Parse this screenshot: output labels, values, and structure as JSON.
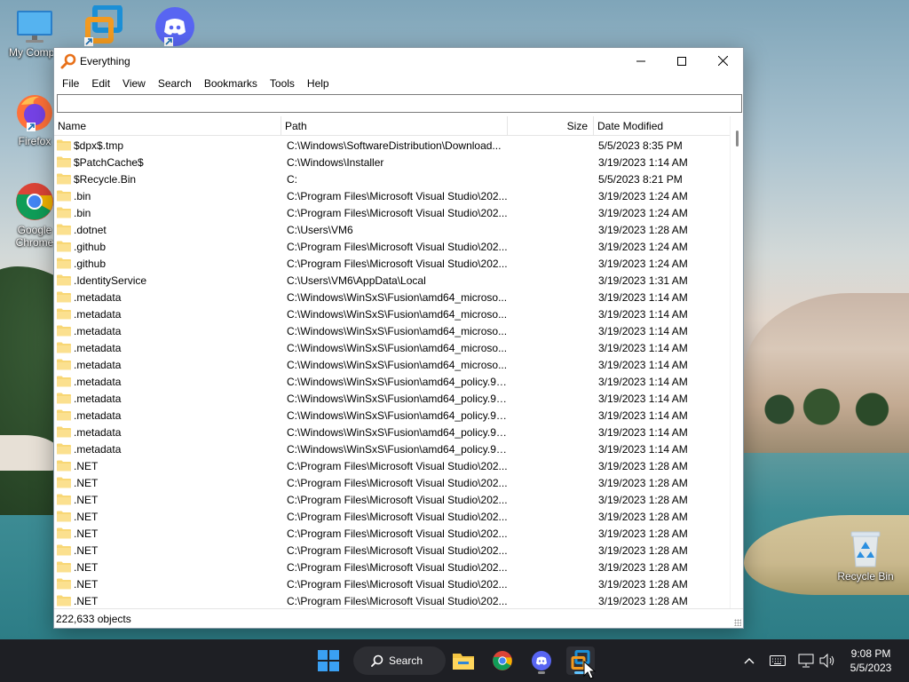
{
  "desktop": {
    "icons": [
      {
        "label": "My Compu",
        "icon": "monitor-icon"
      },
      {
        "label": "",
        "icon": "vmware-icon"
      },
      {
        "label": "",
        "icon": "discord-icon"
      },
      {
        "label": "Firefox",
        "icon": "firefox-icon"
      },
      {
        "label": "Google Chrome",
        "icon": "chrome-icon"
      },
      {
        "label": "Recycle Bin",
        "icon": "recycle-bin-icon"
      }
    ]
  },
  "window": {
    "title": "Everything",
    "menu": [
      "File",
      "Edit",
      "View",
      "Search",
      "Bookmarks",
      "Tools",
      "Help"
    ],
    "search_value": "",
    "columns": {
      "name": "Name",
      "path": "Path",
      "size": "Size",
      "date": "Date Modified"
    },
    "rows": [
      {
        "name": "$dpx$.tmp",
        "path": "C:\\Windows\\SoftwareDistribution\\Download...",
        "size": "",
        "date": "5/5/2023 8:35 PM"
      },
      {
        "name": "$PatchCache$",
        "path": "C:\\Windows\\Installer",
        "size": "",
        "date": "3/19/2023 1:14 AM"
      },
      {
        "name": "$Recycle.Bin",
        "path": "C:",
        "size": "",
        "date": "5/5/2023 8:21 PM"
      },
      {
        "name": ".bin",
        "path": "C:\\Program Files\\Microsoft Visual Studio\\202...",
        "size": "",
        "date": "3/19/2023 1:24 AM"
      },
      {
        "name": ".bin",
        "path": "C:\\Program Files\\Microsoft Visual Studio\\202...",
        "size": "",
        "date": "3/19/2023 1:24 AM"
      },
      {
        "name": ".dotnet",
        "path": "C:\\Users\\VM6",
        "size": "",
        "date": "3/19/2023 1:28 AM"
      },
      {
        "name": ".github",
        "path": "C:\\Program Files\\Microsoft Visual Studio\\202...",
        "size": "",
        "date": "3/19/2023 1:24 AM"
      },
      {
        "name": ".github",
        "path": "C:\\Program Files\\Microsoft Visual Studio\\202...",
        "size": "",
        "date": "3/19/2023 1:24 AM"
      },
      {
        "name": ".IdentityService",
        "path": "C:\\Users\\VM6\\AppData\\Local",
        "size": "",
        "date": "3/19/2023 1:31 AM"
      },
      {
        "name": ".metadata",
        "path": "C:\\Windows\\WinSxS\\Fusion\\amd64_microso...",
        "size": "",
        "date": "3/19/2023 1:14 AM"
      },
      {
        "name": ".metadata",
        "path": "C:\\Windows\\WinSxS\\Fusion\\amd64_microso...",
        "size": "",
        "date": "3/19/2023 1:14 AM"
      },
      {
        "name": ".metadata",
        "path": "C:\\Windows\\WinSxS\\Fusion\\amd64_microso...",
        "size": "",
        "date": "3/19/2023 1:14 AM"
      },
      {
        "name": ".metadata",
        "path": "C:\\Windows\\WinSxS\\Fusion\\amd64_microso...",
        "size": "",
        "date": "3/19/2023 1:14 AM"
      },
      {
        "name": ".metadata",
        "path": "C:\\Windows\\WinSxS\\Fusion\\amd64_microso...",
        "size": "",
        "date": "3/19/2023 1:14 AM"
      },
      {
        "name": ".metadata",
        "path": "C:\\Windows\\WinSxS\\Fusion\\amd64_policy.9....",
        "size": "",
        "date": "3/19/2023 1:14 AM"
      },
      {
        "name": ".metadata",
        "path": "C:\\Windows\\WinSxS\\Fusion\\amd64_policy.9....",
        "size": "",
        "date": "3/19/2023 1:14 AM"
      },
      {
        "name": ".metadata",
        "path": "C:\\Windows\\WinSxS\\Fusion\\amd64_policy.9....",
        "size": "",
        "date": "3/19/2023 1:14 AM"
      },
      {
        "name": ".metadata",
        "path": "C:\\Windows\\WinSxS\\Fusion\\amd64_policy.9....",
        "size": "",
        "date": "3/19/2023 1:14 AM"
      },
      {
        "name": ".metadata",
        "path": "C:\\Windows\\WinSxS\\Fusion\\amd64_policy.9....",
        "size": "",
        "date": "3/19/2023 1:14 AM"
      },
      {
        "name": ".NET",
        "path": "C:\\Program Files\\Microsoft Visual Studio\\202...",
        "size": "",
        "date": "3/19/2023 1:28 AM"
      },
      {
        "name": ".NET",
        "path": "C:\\Program Files\\Microsoft Visual Studio\\202...",
        "size": "",
        "date": "3/19/2023 1:28 AM"
      },
      {
        "name": ".NET",
        "path": "C:\\Program Files\\Microsoft Visual Studio\\202...",
        "size": "",
        "date": "3/19/2023 1:28 AM"
      },
      {
        "name": ".NET",
        "path": "C:\\Program Files\\Microsoft Visual Studio\\202...",
        "size": "",
        "date": "3/19/2023 1:28 AM"
      },
      {
        "name": ".NET",
        "path": "C:\\Program Files\\Microsoft Visual Studio\\202...",
        "size": "",
        "date": "3/19/2023 1:28 AM"
      },
      {
        "name": ".NET",
        "path": "C:\\Program Files\\Microsoft Visual Studio\\202...",
        "size": "",
        "date": "3/19/2023 1:28 AM"
      },
      {
        "name": ".NET",
        "path": "C:\\Program Files\\Microsoft Visual Studio\\202...",
        "size": "",
        "date": "3/19/2023 1:28 AM"
      },
      {
        "name": ".NET",
        "path": "C:\\Program Files\\Microsoft Visual Studio\\202...",
        "size": "",
        "date": "3/19/2023 1:28 AM"
      },
      {
        "name": ".NET",
        "path": "C:\\Program Files\\Microsoft Visual Studio\\202...",
        "size": "",
        "date": "3/19/2023 1:28 AM"
      }
    ],
    "status": "222,633 objects"
  },
  "taskbar": {
    "search_label": "Search",
    "apps": [
      "file-explorer-icon",
      "chrome-icon",
      "discord-icon",
      "vmware-icon"
    ],
    "active_app": "vmware-icon",
    "time": "9:08 PM",
    "date": "5/5/2023"
  },
  "colors": {
    "folder": "#f8d775",
    "taskbar": "#1e1f24",
    "accent": "#0078d7"
  }
}
